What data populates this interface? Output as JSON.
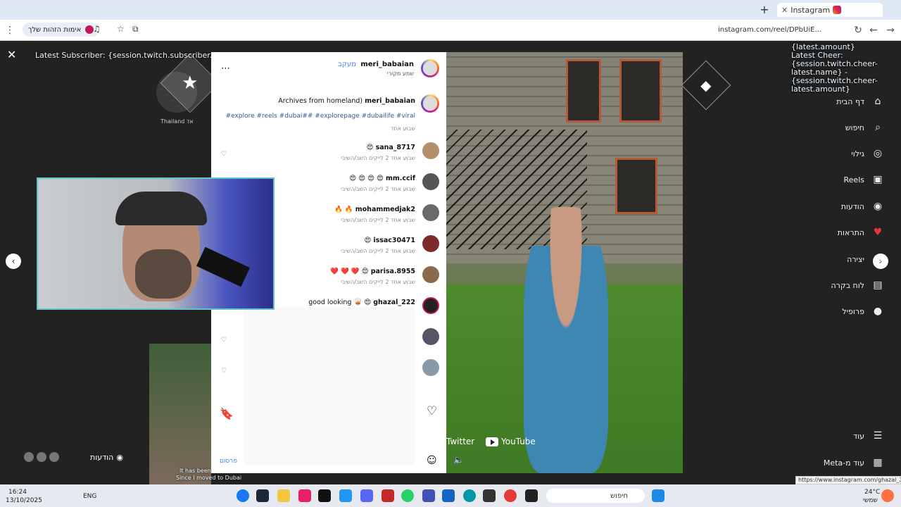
{
  "browser": {
    "tab_title": "Instagram",
    "url": "instagram.com/reel/DPbUiE...",
    "tab_close": "✕",
    "new_tab": "+",
    "pill_label": "אימות הזהות שלך",
    "status_url": "https://www.instagram.com/ghazal_222/"
  },
  "overlay": {
    "latest_subscriber": "Latest Subscriber: {session.twitch.subscriber.latest.name}",
    "latest_amount": "{latest.amount}",
    "latest_cheer_label": "Latest Cheer:",
    "latest_cheer_line2": "{session.twitch.cheer-",
    "latest_cheer_line3": "latest.name} -",
    "latest_cheer_line4": "{session.twitch.cheer-",
    "latest_cheer_line5": "latest.amount}",
    "profile_country": "Thailand אד",
    "twitter": "Twitter",
    "youtube": "YouTube",
    "it_has_been": "It has been",
    "since_moved": "Since I moved to Dubai"
  },
  "sidebar": {
    "items": [
      {
        "label": "דף הבית",
        "icon": "home-icon"
      },
      {
        "label": "חיפוש",
        "icon": "search-icon"
      },
      {
        "label": "גילוי",
        "icon": "compass-icon"
      },
      {
        "label": "Reels",
        "icon": "reels-icon"
      },
      {
        "label": "הודעות",
        "icon": "messenger-icon"
      },
      {
        "label": "התראות",
        "icon": "heart-icon"
      },
      {
        "label": "יצירה",
        "icon": "plus-icon"
      },
      {
        "label": "לוח בקרה",
        "icon": "chart-icon"
      },
      {
        "label": "פרופיל",
        "icon": "avatar-icon"
      },
      {
        "label": "עוד",
        "icon": "menu-icon"
      },
      {
        "label": "Meta-עוד מ",
        "icon": "grid-icon"
      }
    ]
  },
  "post": {
    "author": "meri_babaian",
    "follow": "מעקב",
    "subtitle": "שמע מקורי",
    "caption": "Archives from homeland)",
    "hashtags": "#explore #reels #dubai## #explorepage #dubailife #viral",
    "caption_ago": "שבוע אחד",
    "publish": "פרסום"
  },
  "comments": [
    {
      "user": "sana_8717",
      "text": "😍",
      "meta": "שבוע אחד  2 לייקים  השב/השיבי"
    },
    {
      "user": "mm.ccif",
      "text": "😍 😍 😍 😍",
      "meta": "שבוע אחד  2 לייקים  השב/השיבי"
    },
    {
      "user": "mohammedjak2",
      "text": "🔥 🔥",
      "meta": "שבוע אחד  2 לייקים  השב/השיבי"
    },
    {
      "user": "issac30471",
      "text": "😍",
      "meta": "שבוע אחד  2 לייקים  השב/השיבי"
    },
    {
      "user": "parisa.8955",
      "text": "❤️ ❤️ ❤️ 😍",
      "meta": "שבוע אחד  2 לייקים  השב/השיבי"
    },
    {
      "user": "ghazal_222",
      "text": "good looking 🥃 😍",
      "meta": ""
    }
  ],
  "taskbar": {
    "time": "16:24",
    "date": "13/10/2025",
    "lang": "ENG",
    "search": "חיפוש",
    "weather": "24°C",
    "weather_sub": "שמשי"
  },
  "bottom_left": {
    "messages_label": "הודעות"
  }
}
